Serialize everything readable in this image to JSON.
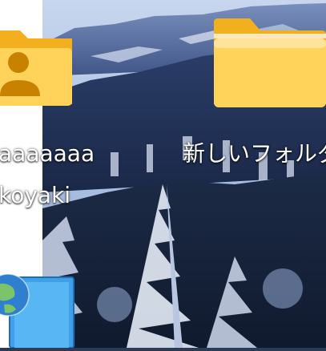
{
  "desktop": {
    "icons": [
      {
        "name": "user-folder",
        "label_line1": "aaaaaaa",
        "label_line2": "koyaki",
        "icon": "user-folder-icon"
      },
      {
        "name": "new-folder",
        "label_line1": "新しいフォルダ",
        "icon": "folder-icon"
      },
      {
        "name": "network-shortcut",
        "icon": "globe-icon"
      }
    ]
  },
  "colors": {
    "folder_back": "#f2b01e",
    "folder_front": "#ffd35a",
    "folder_front_light": "#ffe39a",
    "user_silhouette": "#c98200",
    "strip": "#ffffff"
  }
}
